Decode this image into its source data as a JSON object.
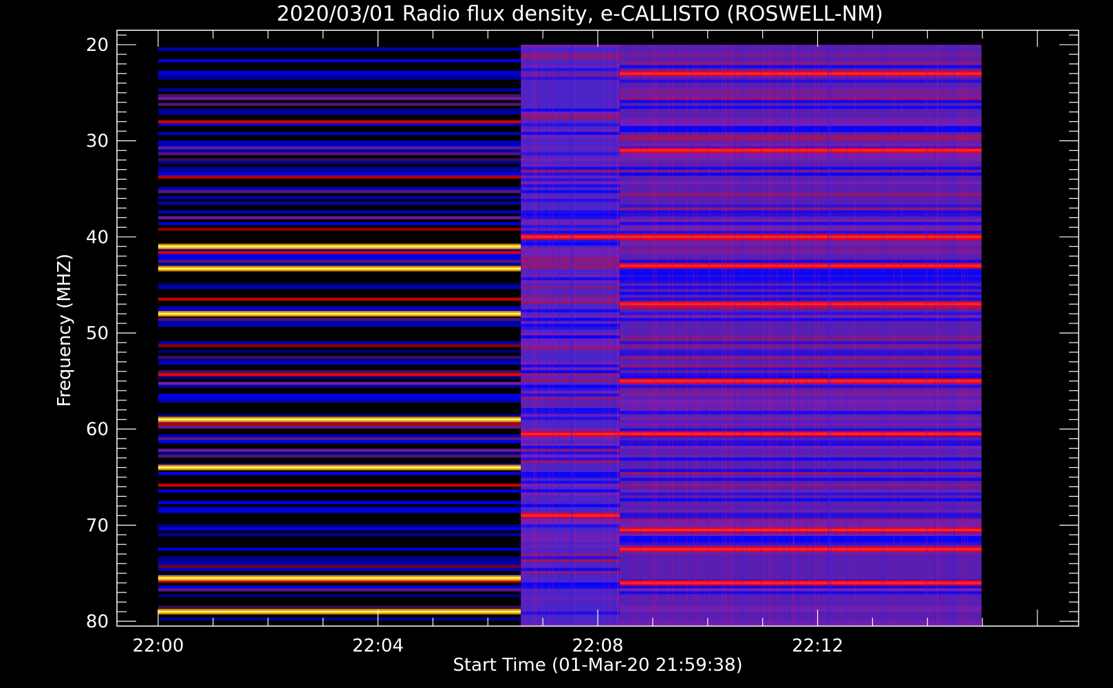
{
  "chart_data": {
    "type": "heatmap",
    "title": "2020/03/01  Radio flux density, e-CALLISTO (ROSWELL-NM)",
    "xlabel": "Start Time (01-Mar-20 21:59:38)",
    "ylabel": "Frequency (MHZ)",
    "x_ticks": [
      "22:00",
      "22:04",
      "22:08",
      "22:12"
    ],
    "y_ticks": [
      20,
      30,
      40,
      50,
      60,
      70,
      80
    ],
    "ylim": [
      18.5,
      80.5
    ],
    "y_inverted": true,
    "xlim": [
      "21:59:15",
      "22:16:45"
    ],
    "data_time_range": [
      "22:00:00",
      "22:14:59"
    ],
    "data_freq_range": [
      20,
      80.5
    ],
    "colormap": [
      "#000000",
      "#0000ff",
      "#7a1fb0",
      "#ff0000",
      "#ffa500",
      "#ffff60"
    ],
    "segments": [
      {
        "start": "22:00:00",
        "end": "22:06:36",
        "background": "#000000",
        "bright_bands_mhz": [
          41,
          43.3,
          48,
          59,
          64,
          75.5,
          79
        ]
      },
      {
        "start": "22:06:36",
        "end": "22:08:24",
        "background": "#4c24c8",
        "bright_bands_mhz": [
          40,
          60.5,
          69
        ]
      },
      {
        "start": "22:08:24",
        "end": "22:14:59",
        "background": "#5a1eb0",
        "bright_bands_mhz": [
          23,
          31,
          40,
          43,
          47,
          55,
          60.5,
          70.5,
          72.5,
          76
        ]
      }
    ]
  }
}
